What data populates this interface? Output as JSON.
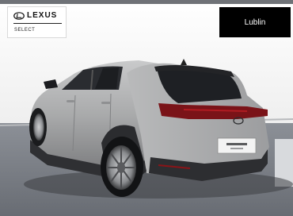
{
  "dealer_logo": {
    "brand_text": "LEXUS",
    "program_text": "SELECT",
    "icon": "lexus-emblem-icon"
  },
  "location_badge": {
    "label": "Lublin"
  },
  "photo": {
    "subject": "car",
    "body_color": "#a9aaab"
  }
}
